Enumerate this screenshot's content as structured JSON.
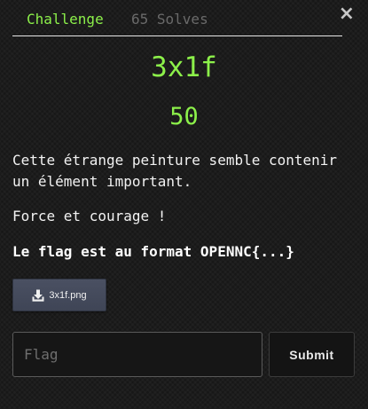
{
  "modal": {
    "close_glyph": "×",
    "tabs": [
      {
        "label": "Challenge",
        "active": true
      },
      {
        "label": "65 Solves",
        "active": false
      }
    ],
    "challenge": {
      "name": "3x1f",
      "value": "50",
      "description": [
        "Cette étrange peinture semble contenir un élément important.",
        "Force et courage !",
        "Le flag est au format OPENNC{...}"
      ]
    },
    "files": [
      {
        "name": "3x1f.png",
        "icon": "download-icon"
      }
    ],
    "flag_input": {
      "placeholder": "Flag",
      "value": ""
    },
    "submit_label": "Submit"
  },
  "colors": {
    "accent": "#8cf04a",
    "muted_tab": "#6a6a6a",
    "background": "#1c1c1c",
    "file_button": "#454b5c"
  }
}
